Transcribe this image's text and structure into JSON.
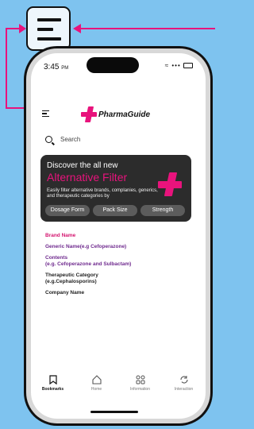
{
  "status": {
    "time": "3:45",
    "ampm": "PM",
    "signal": "•••"
  },
  "brand": {
    "name": "PharmaGuide",
    "accent": "#e8137c"
  },
  "search": {
    "placeholder": "Search"
  },
  "banner": {
    "line1": "Discover the all new",
    "line2": "Alternative Filter",
    "description": "Easily filter alternative brands, complanies, generics, and therapeutic categories by",
    "chips": [
      "Dosage Form",
      "Pack Size",
      "Strength"
    ]
  },
  "fields": {
    "brand_name": "Brand Name",
    "generic_name": "Generic Name(e.g Cefoperazone)",
    "contents_title": "Contents",
    "contents_example": "(e.g. Cefoperazone and Sulbactam)",
    "therapeutic_title": "Therapeutic Category",
    "therapeutic_example": "(e.g.Cephalosporins)",
    "company_name": "Company Name"
  },
  "tabs": [
    {
      "label": "Bookmarks",
      "icon": "bookmark-icon"
    },
    {
      "label": "Home",
      "icon": "home-icon"
    },
    {
      "label": "Information",
      "icon": "grid-icon"
    },
    {
      "label": "Interaction",
      "icon": "refresh-icon"
    }
  ]
}
